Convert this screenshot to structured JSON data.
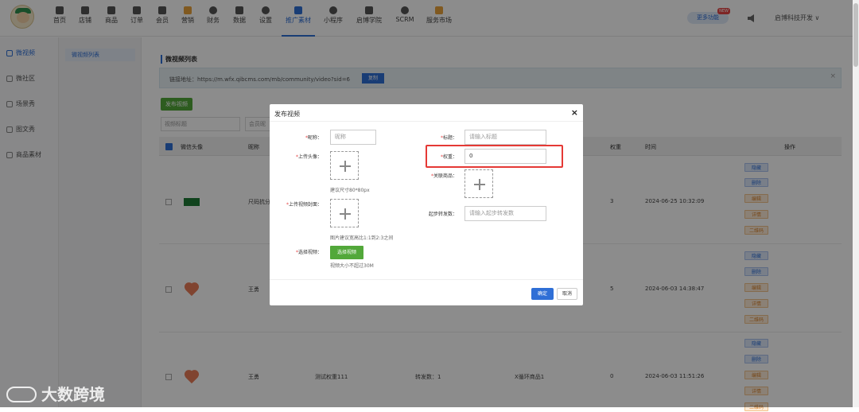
{
  "nav": {
    "items": [
      {
        "label": "首页",
        "icon": "home-icon"
      },
      {
        "label": "店铺",
        "icon": "store-icon"
      },
      {
        "label": "商品",
        "icon": "goods-icon"
      },
      {
        "label": "订单",
        "icon": "order-icon"
      },
      {
        "label": "会员",
        "icon": "member-icon"
      },
      {
        "label": "营销",
        "icon": "marketing-icon"
      },
      {
        "label": "财务",
        "icon": "finance-icon"
      },
      {
        "label": "数据",
        "icon": "data-icon"
      },
      {
        "label": "设置",
        "icon": "settings-icon"
      },
      {
        "label": "推广素材",
        "icon": "share-icon"
      },
      {
        "label": "小程序",
        "icon": "miniprogram-icon"
      },
      {
        "label": "启博学院",
        "icon": "academy-icon"
      },
      {
        "label": "SCRM",
        "icon": "scrm-icon"
      },
      {
        "label": "服务市场",
        "icon": "market-icon"
      }
    ],
    "active_index": 9,
    "more_label": "更多功能",
    "new_badge": "NEW",
    "company": "启博科技开发 ∨"
  },
  "sidebar": {
    "items": [
      {
        "label": "微视频"
      },
      {
        "label": "微社区"
      },
      {
        "label": "场景秀"
      },
      {
        "label": "图文秀"
      },
      {
        "label": "商品素材"
      }
    ],
    "sub_item": "微视频列表"
  },
  "main": {
    "title": "微视频列表",
    "link_label": "链接地址：https://m.wfx.qibcms.com/mb/community/video?sid=6",
    "copy_label": "复制",
    "link_close": "×",
    "publish_label": "发布视频",
    "filters": {
      "video_title": "视频标题",
      "member_name": "会员昵"
    },
    "columns": {
      "avatar": "微信头像",
      "nickname": "昵称",
      "weight": "权重",
      "time": "时间",
      "actions": "操作"
    },
    "rows": [
      {
        "nickname": "尺码抗分",
        "title": "",
        "shares": "",
        "goods": "",
        "weight": "3",
        "time": "2024-06-25 10:32:09",
        "actions": [
          "隐藏",
          "删除",
          "编辑",
          "详情",
          "二维码"
        ]
      },
      {
        "nickname": "王勇",
        "title": "",
        "shares": "",
        "goods": "",
        "weight": "5",
        "time": "2024-06-03 14:38:47",
        "actions": [
          "隐藏",
          "删除",
          "编辑",
          "详情",
          "二维码"
        ]
      },
      {
        "nickname": "王勇",
        "title": "测试权重111",
        "shares": "转发数：1",
        "goods": "X循环商品1",
        "weight": "0",
        "time": "2024-06-03 11:51:26",
        "actions": [
          "隐藏",
          "删除",
          "编辑",
          "详情",
          "二维码"
        ]
      }
    ]
  },
  "modal": {
    "title": "发布视频",
    "close": "×",
    "nickname_label": "昵称：",
    "nickname_placeholder": "昵称",
    "title_label": "标题：",
    "title_placeholder": "请输入标题",
    "avatar_label": "上传头像：",
    "avatar_hint": "建议尺寸80*80px",
    "weight_label": "权重：",
    "weight_value": "0",
    "goods_label": "关联商品：",
    "cover_label": "上传视频封面：",
    "cover_hint": "图片建议宽高比1:1到2:3之间",
    "start_shares_label": "起步转发数：",
    "start_shares_placeholder": "请输入起步转发数",
    "video_label": "选择视频：",
    "video_button": "选择视频",
    "video_hint": "视频大小不超过30M",
    "confirm": "确定",
    "cancel": "取消"
  },
  "watermark": "大数跨境",
  "colors": {
    "accent": "#2f6fd6",
    "green": "#52a83a",
    "highlight": "#e53935"
  }
}
